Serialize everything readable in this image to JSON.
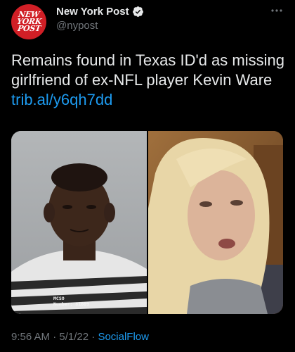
{
  "account": {
    "avatar_lines": [
      "NEW",
      "YORK",
      "POST"
    ],
    "display_name": "New York Post",
    "handle": "@nypost",
    "verified": true
  },
  "tweet": {
    "text": "Remains found in Texas ID'd as missing girlfriend of ex-NFL player Kevin Ware ",
    "link": "trib.al/y6qh7dd"
  },
  "media": {
    "mugshot_caption_line1": "MCSO",
    "mugshot_caption_line2": "Number: 81609"
  },
  "meta": {
    "time": "9:56 AM",
    "separator": " · ",
    "date": "5/1/22",
    "source": "SocialFlow"
  },
  "colors": {
    "background": "#000000",
    "text": "#e7e9ea",
    "secondary": "#71767b",
    "link": "#1d9bf0",
    "avatar": "#d11f26"
  },
  "icons": {
    "verified": "verified-badge-icon",
    "more": "more-horizontal-icon"
  }
}
